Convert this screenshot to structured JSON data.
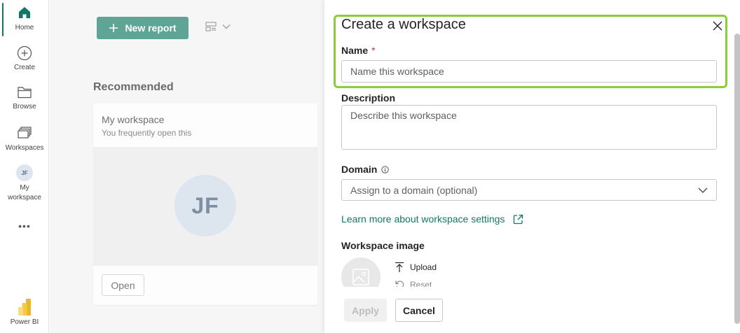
{
  "rail": {
    "items": [
      {
        "label": "Home",
        "icon": "home-icon"
      },
      {
        "label": "Create",
        "icon": "create-icon"
      },
      {
        "label": "Browse",
        "icon": "browse-icon"
      },
      {
        "label": "Workspaces",
        "icon": "workspaces-icon"
      },
      {
        "label_line1": "My",
        "label_line2": "workspace",
        "avatar": "JF"
      },
      {
        "label": "•••",
        "icon": "more-icon"
      },
      {
        "label": "Power BI",
        "icon": "powerbi-logo"
      }
    ]
  },
  "background": {
    "new_report_label": "New report",
    "recommended_title": "Recommended",
    "card": {
      "title": "My workspace",
      "subtitle": "You frequently open this",
      "avatar": "JF",
      "open_label": "Open"
    }
  },
  "panel": {
    "title": "Create a workspace",
    "name_label": "Name",
    "required_mark": "*",
    "name_placeholder": "Name this workspace",
    "description_label": "Description",
    "description_placeholder": "Describe this workspace",
    "domain_label": "Domain",
    "domain_placeholder": "Assign to a domain (optional)",
    "learn_more": "Learn more about workspace settings",
    "workspace_image_label": "Workspace image",
    "upload_label": "Upload",
    "reset_label": "Reset",
    "apply_label": "Apply",
    "cancel_label": "Cancel"
  },
  "colors": {
    "accent": "#117865",
    "highlight": "#8ccc3e",
    "new_report_bg": "#5fa596"
  }
}
